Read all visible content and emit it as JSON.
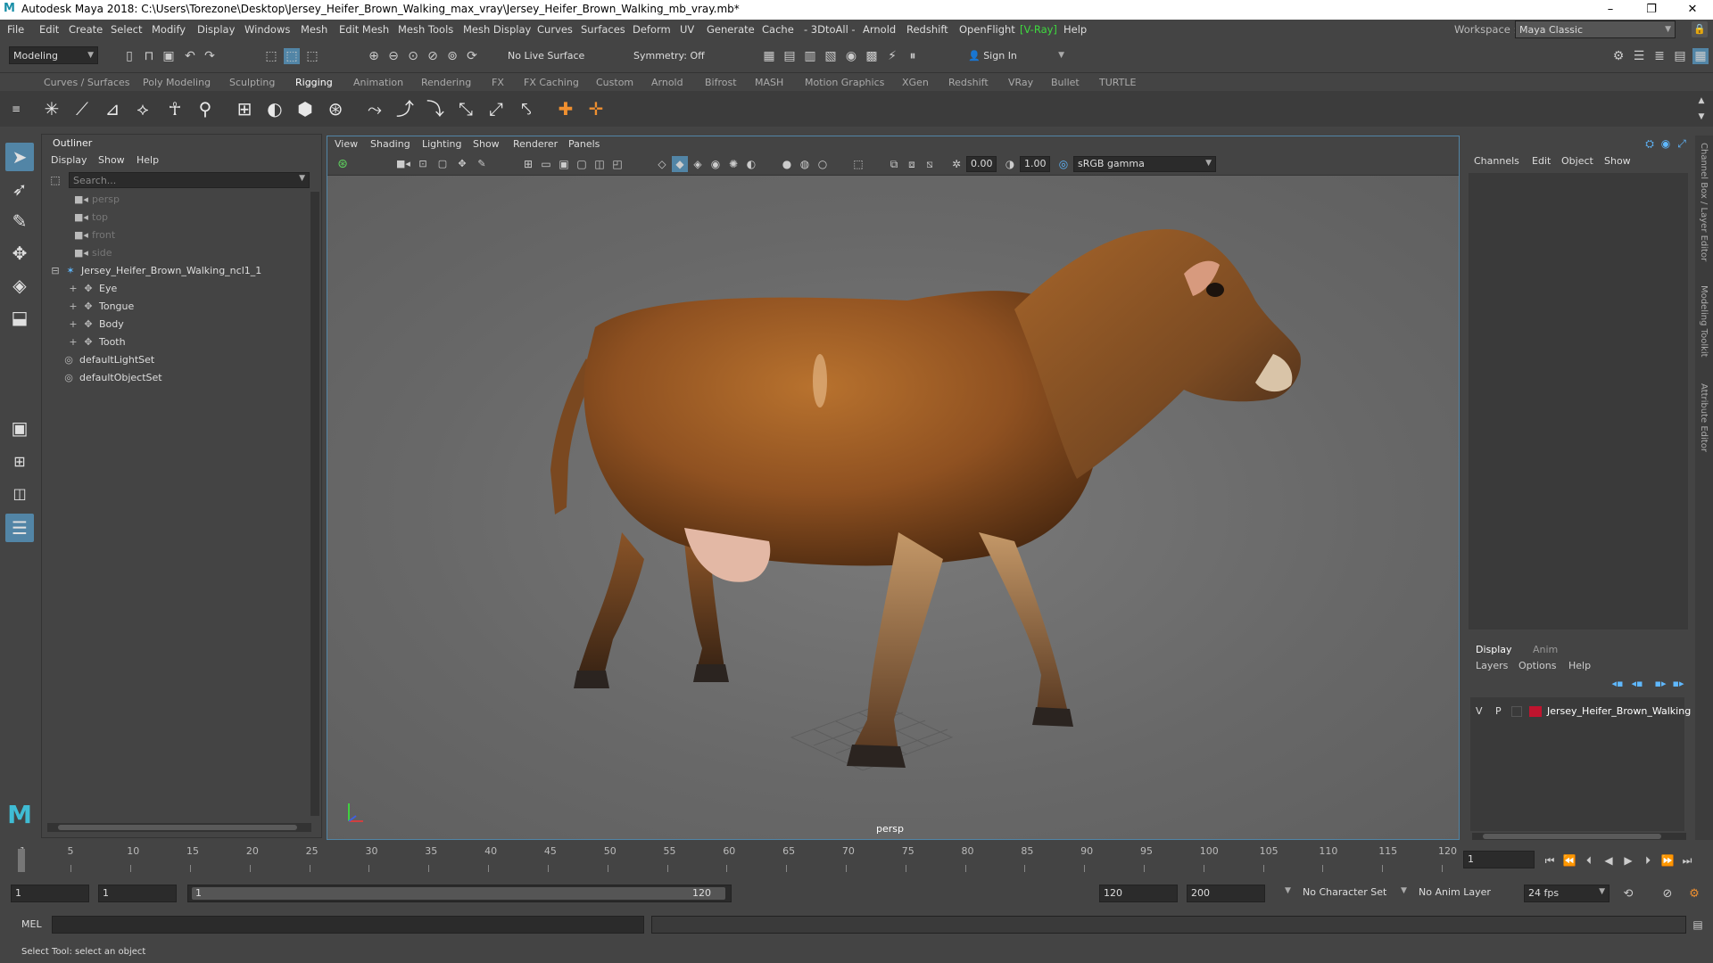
{
  "titlebar": {
    "title": "Autodesk Maya 2018: C:\\Users\\Torezone\\Desktop\\Jersey_Heifer_Brown_Walking_max_vray\\Jersey_Heifer_Brown_Walking_mb_vray.mb*",
    "minimize": "–",
    "maximize": "❐",
    "close": "✕"
  },
  "menubar": {
    "items": [
      "File",
      "Edit",
      "Create",
      "Select",
      "Modify",
      "Display",
      "Windows",
      "Mesh",
      "Edit Mesh",
      "Mesh Tools",
      "Mesh Display",
      "Curves",
      "Surfaces",
      "Deform",
      "UV",
      "Generate",
      "Cache",
      "- 3DtoAll -",
      "Arnold",
      "Redshift",
      "OpenFlight",
      "[V-Ray]",
      "Help"
    ],
    "workspace_label": "Workspace :",
    "workspace_value": "Maya Classic"
  },
  "statusline": {
    "mode": "Modeling",
    "live_surface": "No Live Surface",
    "symmetry": "Symmetry: Off",
    "sign_in": "Sign In"
  },
  "shelf": {
    "tabs": [
      "Curves / Surfaces",
      "Poly Modeling",
      "Sculpting",
      "Rigging",
      "Animation",
      "Rendering",
      "FX",
      "FX Caching",
      "Custom",
      "Arnold",
      "Bifrost",
      "MASH",
      "Motion Graphics",
      "XGen",
      "Redshift",
      "VRay",
      "Bullet",
      "TURTLE"
    ],
    "active_tab": "Rigging"
  },
  "outliner": {
    "title": "Outliner",
    "menus": [
      "Display",
      "Show",
      "Help"
    ],
    "search_placeholder": "Search...",
    "items": [
      {
        "label": "persp",
        "dim": true
      },
      {
        "label": "top",
        "dim": true
      },
      {
        "label": "front",
        "dim": true
      },
      {
        "label": "side",
        "dim": true
      },
      {
        "label": "Jersey_Heifer_Brown_Walking_ncl1_1",
        "dim": false
      },
      {
        "label": "Eye",
        "dim": false
      },
      {
        "label": "Tongue",
        "dim": false
      },
      {
        "label": "Body",
        "dim": false
      },
      {
        "label": "Tooth",
        "dim": false
      },
      {
        "label": "defaultLightSet",
        "dim": false
      },
      {
        "label": "defaultObjectSet",
        "dim": false
      }
    ]
  },
  "viewport": {
    "menus": [
      "View",
      "Shading",
      "Lighting",
      "Show",
      "Renderer",
      "Panels"
    ],
    "near_value": "0.00",
    "far_value": "1.00",
    "color_space": "sRGB gamma",
    "camera_label": "persp"
  },
  "channelbox": {
    "menus": [
      "Channels",
      "Edit",
      "Object",
      "Show"
    ],
    "layer_tabs": [
      "Display",
      "Anim"
    ],
    "layer_menus": [
      "Layers",
      "Options",
      "Help"
    ],
    "layer": {
      "v": "V",
      "p": "P",
      "name": "Jersey_Heifer_Brown_Walking",
      "color": "#c0142e"
    },
    "side_labels": [
      "Channel Box / Layer Editor",
      "Modeling Toolkit",
      "Attribute Editor"
    ]
  },
  "timeslider": {
    "ticks": [
      "1",
      "5",
      "10",
      "15",
      "20",
      "25",
      "30",
      "35",
      "40",
      "45",
      "50",
      "55",
      "60",
      "65",
      "70",
      "75",
      "80",
      "85",
      "90",
      "95",
      "100",
      "105",
      "110",
      "115",
      "120"
    ],
    "current_frame": "1"
  },
  "rangeslider": {
    "start": "1",
    "playback_start": "1",
    "range_start": "1",
    "range_end": "120",
    "playback_end": "120",
    "end": "200",
    "character_set": "No Character Set",
    "anim_layer": "No Anim Layer",
    "fps": "24 fps"
  },
  "cmdline": {
    "label": "MEL"
  },
  "helpline": {
    "text": "Select Tool: select an object"
  }
}
